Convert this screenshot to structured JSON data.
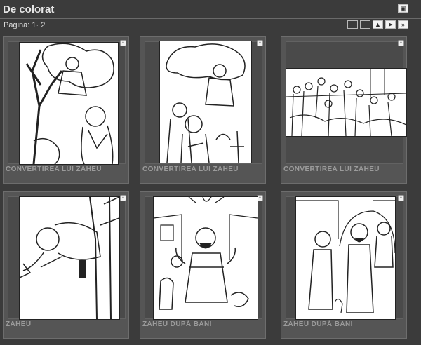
{
  "header": {
    "title": "De colorat",
    "button_icon": "view-icon"
  },
  "pagination": {
    "label": "Pagina: 1· 2",
    "buttons": [
      "blank",
      "blank",
      "up",
      "next",
      "last"
    ]
  },
  "cards": [
    {
      "caption": "CONVERTIREA LUI ZAHEU",
      "scene": "zacchaeus-tree-jesus"
    },
    {
      "caption": "CONVERTIREA LUI ZAHEU",
      "scene": "zacchaeus-tree-crowd"
    },
    {
      "caption": "CONVERTIREA LUI ZAHEU",
      "scene": "crowd-street"
    },
    {
      "caption": "ZAHEU",
      "scene": "zacchaeus-climbing"
    },
    {
      "caption": "ZAHEU DUPĂ BANI",
      "scene": "zacchaeus-money"
    },
    {
      "caption": "ZAHEU DUPĂ BANI",
      "scene": "zacchaeus-giving"
    }
  ]
}
